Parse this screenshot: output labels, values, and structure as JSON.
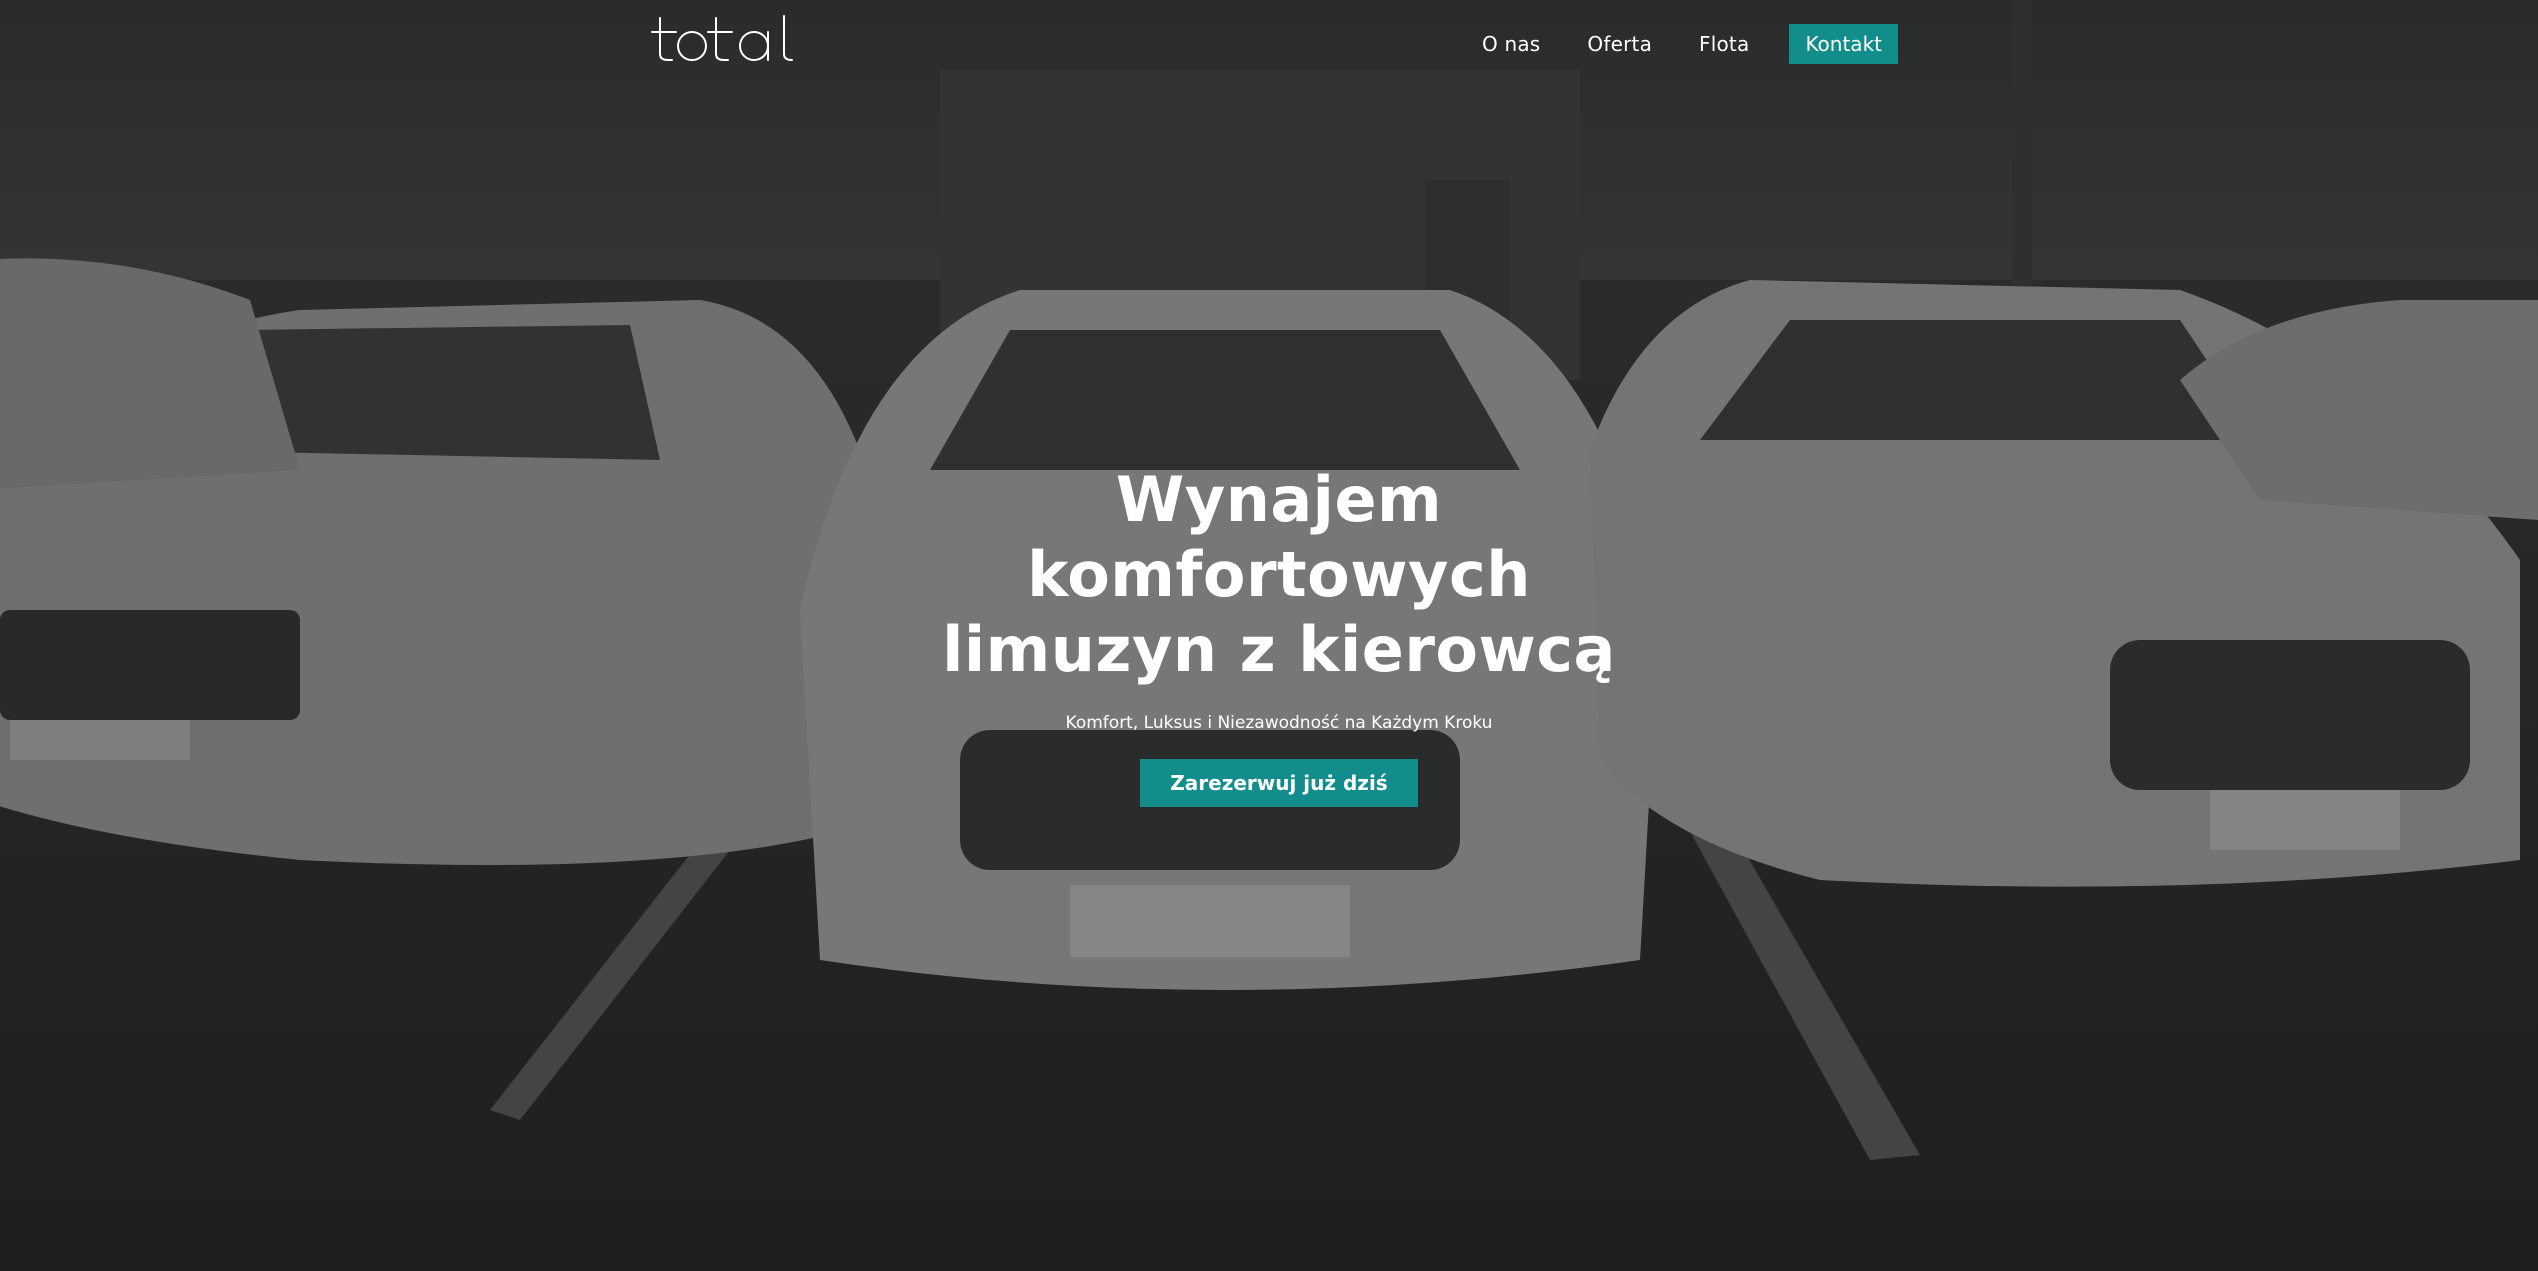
{
  "brand": {
    "logo_text": "total"
  },
  "nav": {
    "items": [
      {
        "label": "O nas"
      },
      {
        "label": "Oferta"
      },
      {
        "label": "Flota"
      }
    ],
    "cta_label": "Kontakt"
  },
  "hero": {
    "title_lines": [
      "Wynajem",
      "komfortowych",
      "limuzyn z kierowcą"
    ],
    "subtitle": "Komfort, Luksus i Niezawodność na Każdym Kroku",
    "button_label": "Zarezerwuj już dziś",
    "background": "dimmed photo of white limousines parked in a row"
  },
  "colors": {
    "accent": "#138c8c",
    "text": "#ffffff",
    "overlay": "#141616"
  }
}
